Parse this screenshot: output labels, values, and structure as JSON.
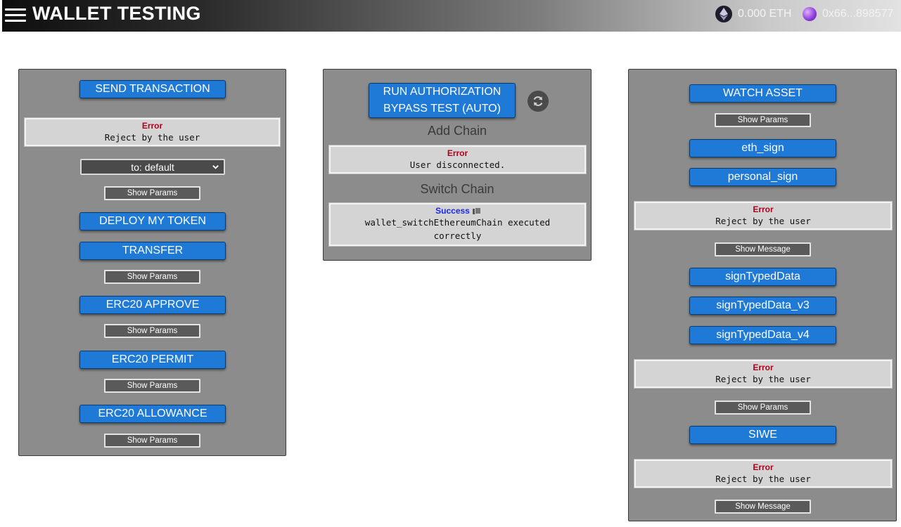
{
  "header": {
    "title": "WALLET TESTING",
    "eth_balance": "0.000 ETH",
    "account_address": "0x66...898577",
    "icons": {
      "menu": "hamburger-menu-icon",
      "eth": "ethereum-icon",
      "account": "account-avatar-icon"
    }
  },
  "colors": {
    "header_bg_start": "#0f0f0f",
    "header_bg_end": "#e2e2e2",
    "panel_bg": "#8c8c8c",
    "primary_button": "#1e7ad6",
    "error_text": "#b0001c",
    "success_text": "#1a28e0"
  },
  "left_panel": {
    "send_transaction": "SEND TRANSACTION",
    "send_result": {
      "status": "Error",
      "message": "Reject by the user"
    },
    "to_select": {
      "selected": "to: default"
    },
    "show_params_1": "Show Params",
    "deploy_token": "DEPLOY MY TOKEN",
    "transfer": "TRANSFER",
    "show_params_2": "Show Params",
    "erc20_approve": "ERC20 APPROVE",
    "show_params_3": "Show Params",
    "erc20_permit": "ERC20 PERMIT",
    "show_params_4": "Show Params",
    "erc20_allowance": "ERC20 ALLOWANCE",
    "show_params_5": "Show Params"
  },
  "middle_panel": {
    "auth_bypass_line1": "RUN AUTHORIZATION",
    "auth_bypass_line2": "BYPASS TEST (AUTO)",
    "add_chain_label": "Add Chain",
    "add_chain_result": {
      "status": "Error",
      "message": "User disconnected."
    },
    "switch_chain_label": "Switch Chain",
    "switch_chain_result": {
      "status": "Success",
      "message_line1": "wallet_switchEthereumChain executed",
      "message_line2": "correctly"
    }
  },
  "right_panel": {
    "watch_asset": "WATCH ASSET",
    "show_params_1": "Show Params",
    "eth_sign": "eth_sign",
    "personal_sign": "personal_sign",
    "sign_result": {
      "status": "Error",
      "message": "Reject by the user"
    },
    "show_message_1": "Show Message",
    "sign_typed_data": "signTypedData",
    "sign_typed_data_v3": "signTypedData_v3",
    "sign_typed_data_v4": "signTypedData_v4",
    "typed_result": {
      "status": "Error",
      "message": "Reject by the user"
    },
    "show_params_2": "Show Params",
    "siwe": "SIWE",
    "siwe_result": {
      "status": "Error",
      "message": "Reject by the user"
    },
    "show_message_2": "Show Message"
  }
}
